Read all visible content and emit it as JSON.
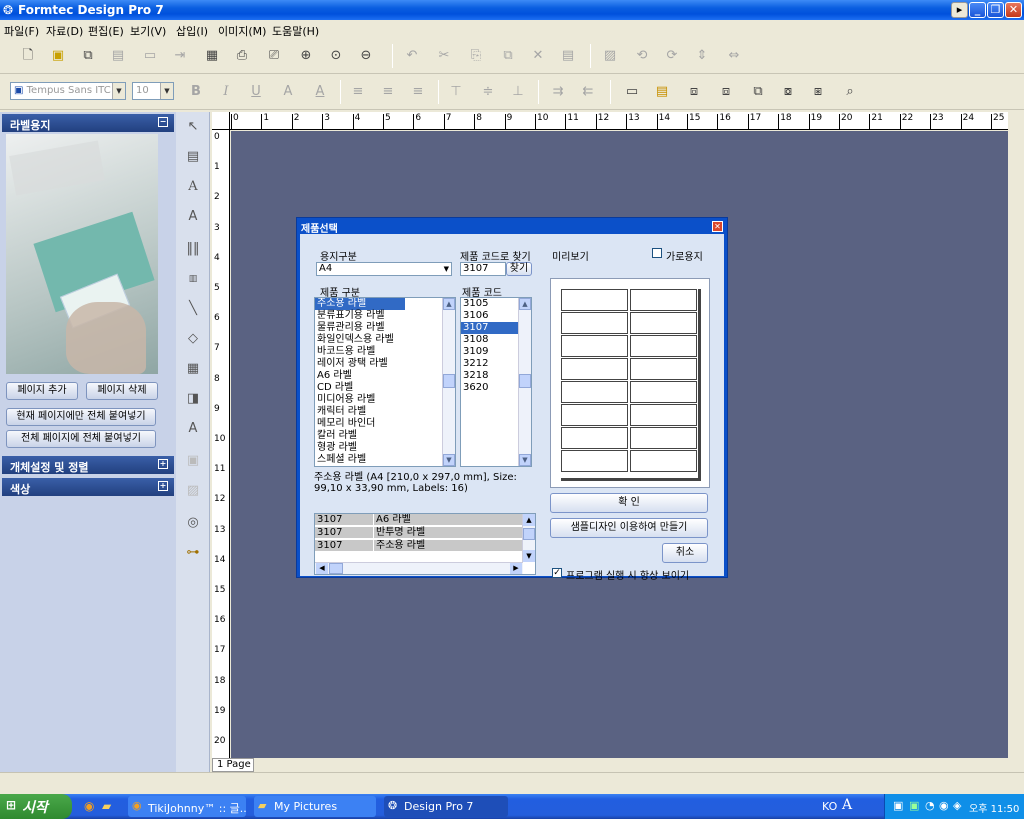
{
  "window": {
    "title": "Formtec Design Pro 7"
  },
  "menu": [
    "파일(F)",
    "자료(D)",
    "편집(E)",
    "보기(V)",
    "삽입(I)",
    "이미지(M)",
    "도움말(H)"
  ],
  "font": {
    "name": "Tempus Sans ITC",
    "size": "10"
  },
  "left_panel": {
    "section_label": "라벨용지",
    "buttons": {
      "add_page": "페이지 추가",
      "delete_page": "페이지 삭제",
      "paste_current": "현재 페이지에만 전체 붙여넣기",
      "paste_all": "전체 페이지에 전체 붙여넣기"
    },
    "section2": "개체설정 및 정렬",
    "section3": "색상"
  },
  "ruler": {
    "h": [
      "0",
      "1",
      "2",
      "3",
      "4",
      "5",
      "6",
      "7",
      "8",
      "9",
      "10",
      "11",
      "12",
      "13",
      "14",
      "15",
      "16",
      "17",
      "18",
      "19",
      "20",
      "21",
      "22",
      "23",
      "24",
      "25"
    ],
    "v": [
      "0",
      "1",
      "2",
      "3",
      "4",
      "5",
      "6",
      "7",
      "8",
      "9",
      "10",
      "11",
      "12",
      "13",
      "14",
      "15",
      "16",
      "17",
      "18",
      "19",
      "20"
    ]
  },
  "page_tab": "1 Page",
  "dialog": {
    "title": "제품선택",
    "paper_type_label": "용지구분",
    "paper_type_value": "A4",
    "find_code_label": "제품 코드로 찾기",
    "find_code_value": "3107",
    "find_button": "찾기",
    "preview_label": "미리보기",
    "landscape_label": "가로용지",
    "category_label": "제품 구분",
    "code_label": "제품 코드",
    "categories": [
      "주소용 라벨",
      "분류표기용 라벨",
      "물류관리용 라벨",
      "화일인덱스용 라벨",
      "바코드용 라벨",
      "레이저 광택 라벨",
      "A6 라벨",
      "CD 라벨",
      "미디어용 라벨",
      "캐릭터 라벨",
      "메모리 바인더",
      "칼러 라벨",
      "형광 라벨",
      "스페셜 라벨"
    ],
    "codes": [
      "3105",
      "3106",
      "3107",
      "3108",
      "3109",
      "3212",
      "3218",
      "3620"
    ],
    "selected_code": "3107",
    "description": "주소용 라벨 (A4 [210,0 x 297,0 mm], Size: 99,10 x 33,90 mm, Labels: 16)",
    "results": [
      {
        "code": "3107",
        "name": "A6 라벨"
      },
      {
        "code": "3107",
        "name": "반투명 라벨"
      },
      {
        "code": "3107",
        "name": "주소용 라벨"
      }
    ],
    "ok_button": "확 인",
    "sample_button": "샘플디자인 이용하여 만들기",
    "cancel_button": "취소",
    "always_show_label": "프로그램 실행 시 항상 보이기"
  },
  "taskbar": {
    "start": "시작",
    "tasks": [
      "TikiJohnny™ :: 글...",
      "My Pictures",
      "Design Pro 7"
    ],
    "lang": "KO",
    "clock": "오후 11:50"
  },
  "colors": {
    "title_bar": "#0a5ee0",
    "canvas": "#5a6282",
    "selection": "#316ac5"
  }
}
